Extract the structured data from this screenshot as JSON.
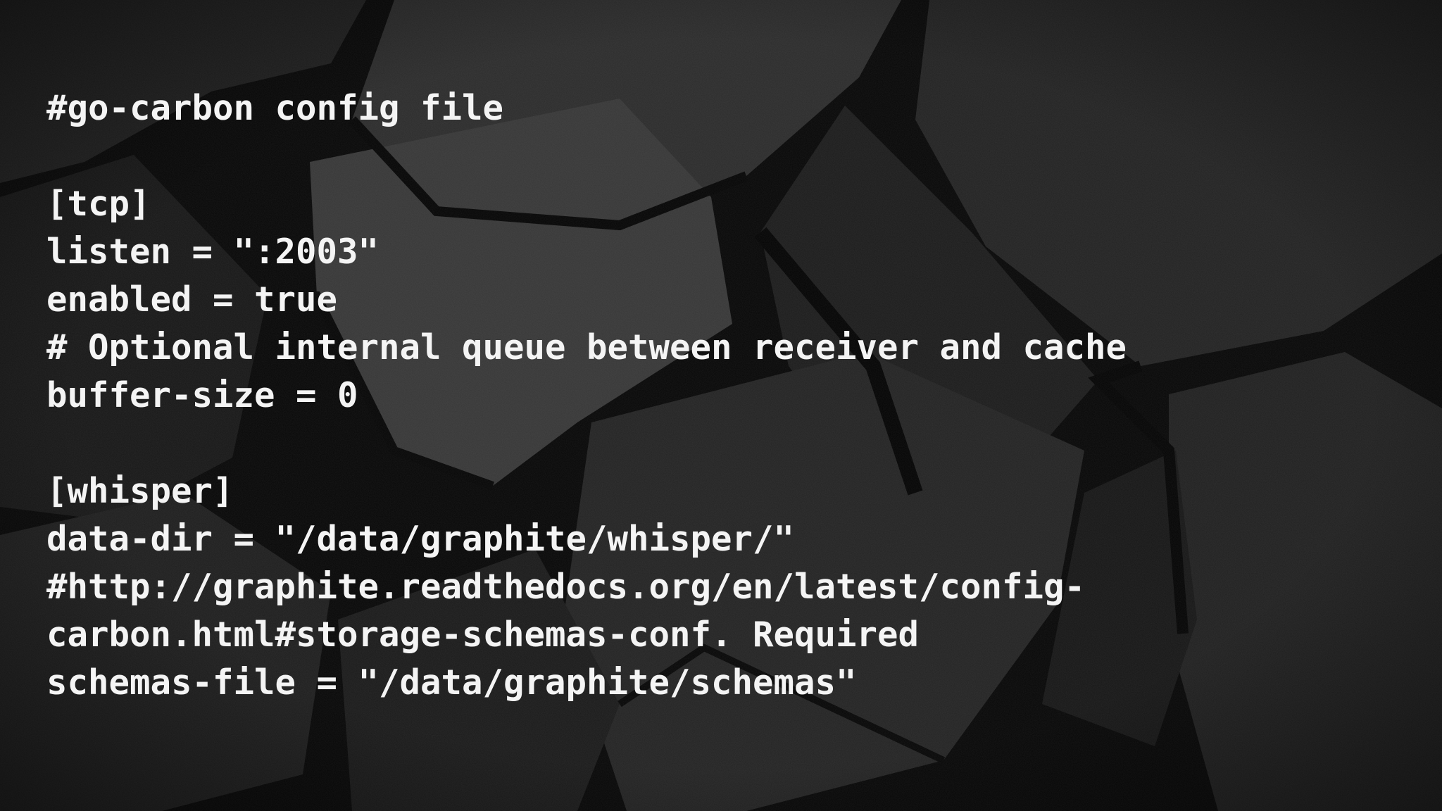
{
  "slide": {
    "background_color": "#151515",
    "text_color": "#f4f4f4",
    "lines": [
      "#go-carbon config file",
      "",
      "[tcp]",
      "listen = \":2003\"",
      "enabled = true",
      "# Optional internal queue between receiver and cache",
      "buffer-size = 0",
      "",
      "[whisper]",
      "data-dir = \"/data/graphite/whisper/\"",
      "#http://graphite.readthedocs.org/en/latest/config-",
      "carbon.html#storage-schemas-conf. Required",
      "schemas-file = \"/data/graphite/schemas\""
    ]
  }
}
